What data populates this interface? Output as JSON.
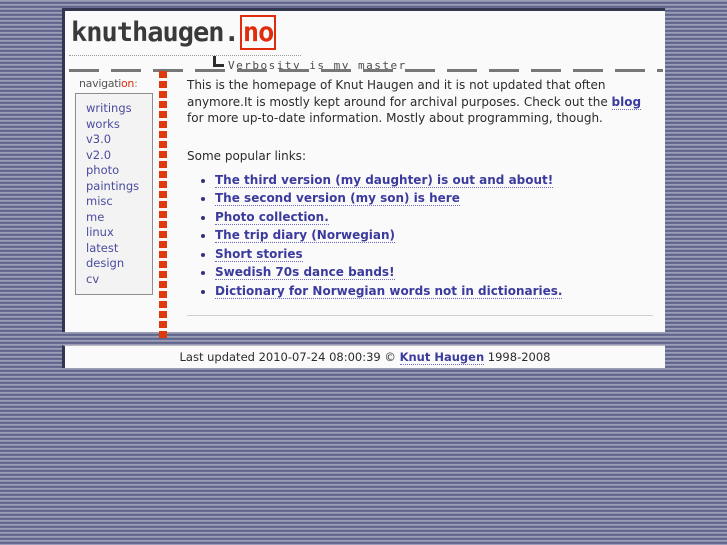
{
  "site": {
    "logo_main": "knuthaugen",
    "logo_dot": ".",
    "logo_tld": "no",
    "tagline": "Verbosity is my master"
  },
  "sidebar": {
    "title_main": "navigati",
    "title_accent": "on",
    "title_tail": ":",
    "items": [
      {
        "label": "writings"
      },
      {
        "label": "works"
      },
      {
        "label": "v3.0"
      },
      {
        "label": "v2.0"
      },
      {
        "label": "photo"
      },
      {
        "label": "paintings"
      },
      {
        "label": "misc"
      },
      {
        "label": "me"
      },
      {
        "label": "linux"
      },
      {
        "label": "latest"
      },
      {
        "label": "design"
      },
      {
        "label": "cv"
      }
    ]
  },
  "main": {
    "intro_part1": "This is the homepage of Knut Haugen and it is not updated that often anymore.It is mostly kept around for archival purposes. Check out the ",
    "intro_link": "blog",
    "intro_part2": " for more up-to-date information. Mostly about programming, though.",
    "popular_heading": "Some popular links:",
    "links": [
      {
        "label": "The third version (my daughter) is out and about!"
      },
      {
        "label": "The second version (my son) is here"
      },
      {
        "label": "Photo collection."
      },
      {
        "label": "The trip diary (Norwegian)"
      },
      {
        "label": "Short stories"
      },
      {
        "label": "Swedish 70s dance bands!"
      },
      {
        "label": "Dictionary for Norwegian words not in dictionaries."
      }
    ]
  },
  "footer": {
    "prefix": "Last updated 2010-07-24 08:00:39 © ",
    "author": "Knut Haugen",
    "years": " 1998-2008"
  },
  "colors": {
    "accent_red": "#e02b0c",
    "link_blue": "#3b3b9e",
    "panel_bg": "#fafafa",
    "page_bg": "#6a6f94"
  }
}
